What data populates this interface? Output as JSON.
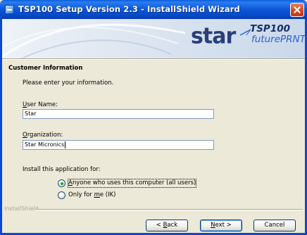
{
  "window": {
    "title": "TSP100 Setup Version 2.3 - InstallShield Wizard"
  },
  "banner": {
    "logo_brand": "star",
    "logo_model": "TSP100",
    "logo_subtitle": "futurePRNT"
  },
  "page": {
    "heading": "Customer Information",
    "subheading": "Please enter your information."
  },
  "form": {
    "user_name": {
      "label_accel": "U",
      "label_rest": "ser Name:",
      "value": "Star"
    },
    "organization": {
      "label_accel": "O",
      "label_rest": "rganization:",
      "value": "Star Micronics"
    },
    "install_for_label": "Install this application for:",
    "options": [
      {
        "accel": "A",
        "rest": "nyone who uses this computer (all users)",
        "selected": true
      },
      {
        "before": "Only for ",
        "accel": "m",
        "after": "e (IK)",
        "selected": false
      }
    ]
  },
  "footer": {
    "brand": "InstallShield",
    "back": {
      "pre": "< ",
      "accel": "B",
      "rest": "ack"
    },
    "next": {
      "accel": "N",
      "rest": "ext >"
    },
    "cancel": "Cancel"
  }
}
